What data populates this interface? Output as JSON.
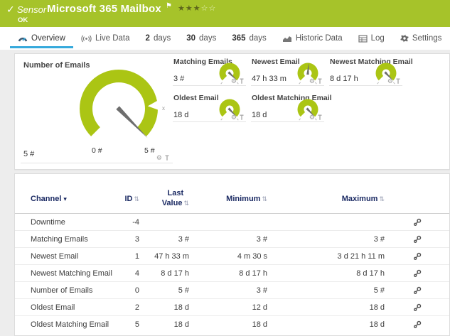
{
  "colors": {
    "brand_green": "#a6c32a",
    "gauge_green": "#abc514",
    "tab_underline": "#35a9dc",
    "table_header_text": "#1b2a63",
    "needle_gray": "#6e6e6e"
  },
  "header": {
    "check_icon": "✓",
    "kind_label": "Sensor",
    "title": "Microsoft 365 Mailbox",
    "flag_icon": "⚑",
    "stars_filled": 3,
    "stars_total": 5,
    "status": "OK"
  },
  "tabs": [
    {
      "label": "Overview",
      "icon": "gauge",
      "active": true
    },
    {
      "label": "Live Data",
      "icon": "broadcast"
    },
    {
      "strong": "2",
      "rest": " days"
    },
    {
      "strong": "30",
      "rest": " days"
    },
    {
      "strong": "365",
      "rest": " days"
    },
    {
      "label": "Historic Data",
      "icon": "chart"
    },
    {
      "label": "Log",
      "icon": "log"
    },
    {
      "label": "Settings",
      "icon": "gear"
    }
  ],
  "overview": {
    "main_gauge": {
      "title": "Number of Emails",
      "value": "5 #",
      "scale_min": "0 #",
      "scale_max": "5 #",
      "limit_marker": "x",
      "needle_deg": 135
    },
    "small_gauges": [
      {
        "title": "Matching Emails",
        "value": "3 #",
        "needle_deg": 133
      },
      {
        "title": "Newest Email",
        "value": "47 h 33 m",
        "needle_deg": 3
      },
      {
        "title": "Newest Matching Email",
        "value": "8 d 17 h",
        "needle_deg": 135
      },
      {
        "title": "Oldest Email",
        "value": "18 d",
        "needle_deg": 135
      },
      {
        "title": "Oldest Matching Email",
        "value": "18 d",
        "needle_deg": 135
      }
    ]
  },
  "table": {
    "header": {
      "channel": "Channel",
      "channel_sort_icon": "▾",
      "id": "ID",
      "last_line1": "Last",
      "last_line2": "Value",
      "minimum": "Minimum",
      "maximum": "Maximum",
      "sort_icon": "⇅"
    },
    "rows": [
      {
        "channel": "Downtime",
        "id": "-4",
        "last": "",
        "min": "",
        "max": ""
      },
      {
        "channel": "Matching Emails",
        "id": "3",
        "last": "3 #",
        "min": "3 #",
        "max": "3 #"
      },
      {
        "channel": "Newest Email",
        "id": "1",
        "last": "47 h 33 m",
        "min": "4 m 30 s",
        "max": "3 d 21 h 11 m"
      },
      {
        "channel": "Newest Matching Email",
        "id": "4",
        "last": "8 d 17 h",
        "min": "8 d 17 h",
        "max": "8 d 17 h"
      },
      {
        "channel": "Number of Emails",
        "id": "0",
        "last": "5 #",
        "min": "3 #",
        "max": "5 #"
      },
      {
        "channel": "Oldest Email",
        "id": "2",
        "last": "18 d",
        "min": "12 d",
        "max": "18 d"
      },
      {
        "channel": "Oldest Matching Email",
        "id": "5",
        "last": "18 d",
        "min": "18 d",
        "max": "18 d"
      }
    ]
  }
}
